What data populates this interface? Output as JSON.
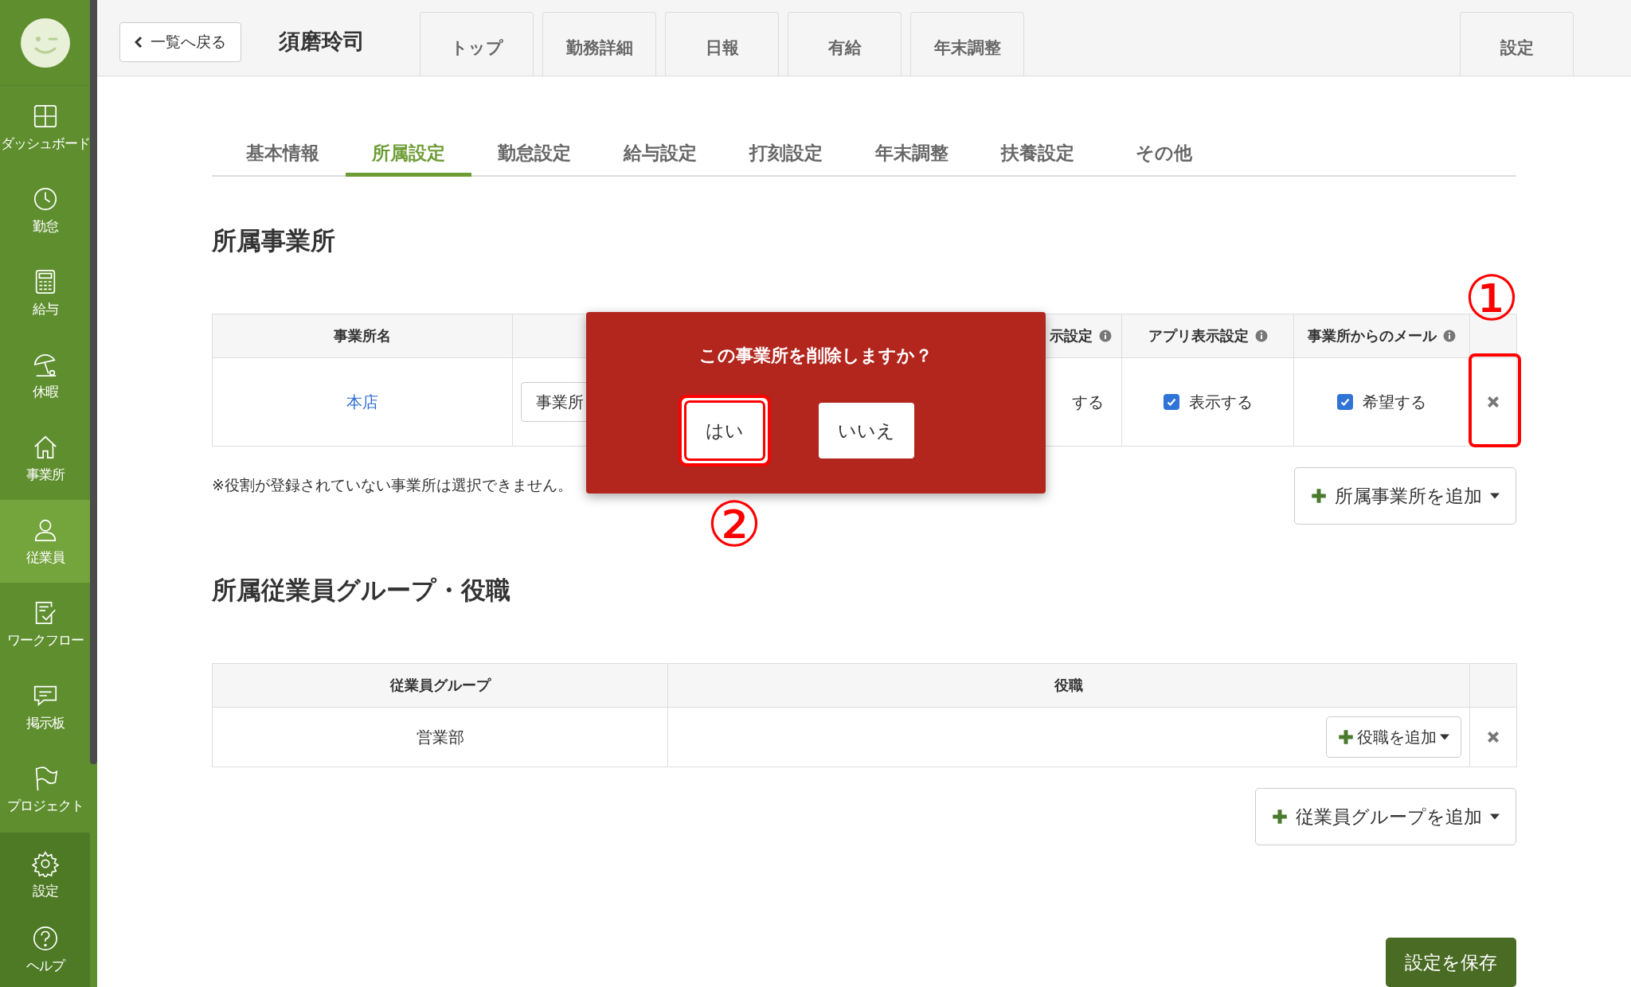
{
  "sidebar": {
    "items": [
      {
        "label": "ダッシュボード",
        "selected": false
      },
      {
        "label": "勤怠",
        "selected": false
      },
      {
        "label": "給与",
        "selected": false
      },
      {
        "label": "休暇",
        "selected": false
      },
      {
        "label": "事業所",
        "selected": false
      },
      {
        "label": "従業員",
        "selected": true
      },
      {
        "label": "ワークフロー",
        "selected": false
      },
      {
        "label": "掲示板",
        "selected": false
      },
      {
        "label": "プロジェクト",
        "selected": false
      }
    ],
    "bottom_items": [
      {
        "label": "設定",
        "selected": false
      },
      {
        "label": "ヘルプ",
        "selected": false
      }
    ]
  },
  "header": {
    "back_button": "一覧へ戻る",
    "employee_name": "須磨玲司",
    "tabs": [
      {
        "label": "トップ",
        "selected": false
      },
      {
        "label": "勤務詳細",
        "selected": false
      },
      {
        "label": "日報",
        "selected": false
      },
      {
        "label": "有給",
        "selected": false
      },
      {
        "label": "年末調整",
        "selected": false
      }
    ],
    "settings_tab": "設定"
  },
  "subtabs": [
    {
      "label": "基本情報",
      "selected": false
    },
    {
      "label": "所属設定",
      "selected": true
    },
    {
      "label": "勤怠設定",
      "selected": false
    },
    {
      "label": "給与設定",
      "selected": false
    },
    {
      "label": "打刻設定",
      "selected": false
    },
    {
      "label": "年末調整",
      "selected": false
    },
    {
      "label": "扶養設定",
      "selected": false
    },
    {
      "label": "その他",
      "selected": false
    }
  ],
  "offices": {
    "title": "所属事業所",
    "columns": [
      {
        "label": "事業所名",
        "info": false
      },
      {
        "label": "示設定",
        "info": true
      },
      {
        "label": "アプリ表示設定",
        "info": true
      },
      {
        "label": "事業所からのメール",
        "info": true
      }
    ],
    "rows": [
      {
        "name": "本店",
        "office_select": "事業所",
        "column_3": "する",
        "app_display": {
          "label": "表示する",
          "checked": true
        },
        "mail": {
          "label": "希望する",
          "checked": true
        },
        "delete_marked": true
      }
    ],
    "note": "※役割が登録されていない事業所は選択できません。",
    "add_button": "所属事業所を追加"
  },
  "groups": {
    "title": "所属従業員グループ・役職",
    "columns": [
      "従業員グループ",
      "役職"
    ],
    "rows": [
      {
        "group": "営業部",
        "add_role_button": "役職を追加"
      }
    ],
    "add_button": "従業員グループを追加"
  },
  "save_button": "設定を保存",
  "dialog": {
    "message": "この事業所を削除しますか？",
    "buttons": [
      {
        "label": "はい",
        "marked": true
      },
      {
        "label": "いいえ",
        "marked": false
      }
    ]
  },
  "annotations": [
    {
      "label": "①"
    },
    {
      "label": "②"
    }
  ]
}
